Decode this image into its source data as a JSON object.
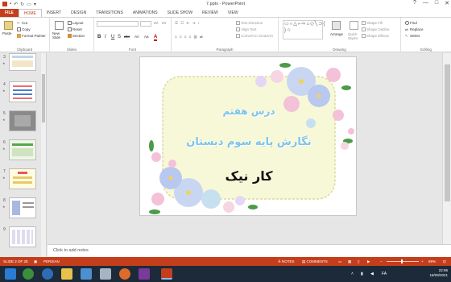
{
  "window": {
    "title": "7.pptx - PowerPoint",
    "controls": [
      "?",
      "—",
      "□",
      "✕"
    ]
  },
  "tabs": [
    "FILE",
    "HOME",
    "INSERT",
    "DESIGN",
    "TRANSITIONS",
    "ANIMATIONS",
    "SLIDE SHOW",
    "REVIEW",
    "VIEW"
  ],
  "active_tab": "HOME",
  "ribbon": {
    "clipboard": {
      "paste": "Paste",
      "cut": "Cut",
      "copy": "Copy",
      "format_painter": "Format Painter",
      "label": "Clipboard"
    },
    "slides": {
      "new_slide": "New Slide",
      "layout": "Layout",
      "reset": "Reset",
      "section": "Section",
      "label": "Slides"
    },
    "font": {
      "label": "Font",
      "bold": "B",
      "italic": "I",
      "underline": "U",
      "strike": "S",
      "abc": "abc",
      "av": "AV",
      "aa": "Aa",
      "a_color": "A"
    },
    "paragraph": {
      "label": "Paragraph",
      "text_direction": "Text Direction",
      "align_text": "Align Text",
      "convert_smartart": "Convert to SmartArt"
    },
    "drawing": {
      "label": "Drawing",
      "arrange": "Arrange",
      "quick_styles": "Quick Styles",
      "shape_fill": "Shape Fill",
      "shape_outline": "Shape Outline",
      "shape_effects": "Shape Effects"
    },
    "editing": {
      "label": "Editing",
      "find": "Find",
      "replace": "Replace",
      "select": "Select"
    }
  },
  "thumbnails": [
    {
      "num": "3"
    },
    {
      "num": "4"
    },
    {
      "num": "5"
    },
    {
      "num": "6"
    },
    {
      "num": "7"
    },
    {
      "num": "8"
    },
    {
      "num": "9"
    }
  ],
  "slide": {
    "line1": "درس هفتم",
    "line2": "نگارش پایه سوم دبستان",
    "line3": "کار نیک",
    "colors": {
      "title": "#7cc4e8",
      "body": "#111111",
      "panel": "#f7f8d8",
      "border": "#d9dc9a"
    }
  },
  "notes_placeholder": "Click to add notes",
  "status": {
    "slide": "SLIDE 2 OF 28",
    "language": "PERSIAN",
    "notes": "NOTES",
    "comments": "COMMENTS",
    "zoom": "69%"
  },
  "taskbar": {
    "time": "22:06",
    "date": "18/09/2021",
    "lang": "FA"
  },
  "accent": "#c43e1c"
}
